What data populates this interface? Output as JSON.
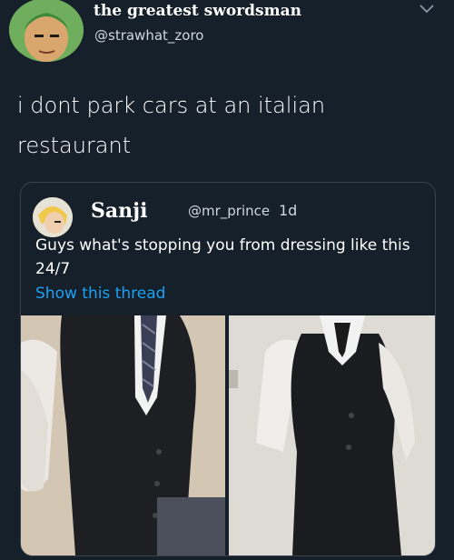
{
  "tweet": {
    "author": {
      "display_name": "the greatest swordsman",
      "handle": "@strawhat_zoro",
      "avatar_icon": "avatar-image"
    },
    "menu_icon": "chevron-down-icon",
    "text": "i dont park cars at an italian restaurant"
  },
  "quoted_tweet": {
    "author": {
      "display_name": "Sanji",
      "handle": "@mr_prince",
      "avatar_icon": "avatar-image"
    },
    "time": "1d",
    "text": "Guys what's stopping you from dressing like this 24/7",
    "show_thread": "Show this thread",
    "photos": [
      {
        "name": "photo-vest-left"
      },
      {
        "name": "photo-vest-right"
      }
    ]
  },
  "colors": {
    "background": "#15202b",
    "border": "#38444d",
    "link": "#1da1f2",
    "text": "#ffffff",
    "secondary_text": "#d0d6dc"
  }
}
